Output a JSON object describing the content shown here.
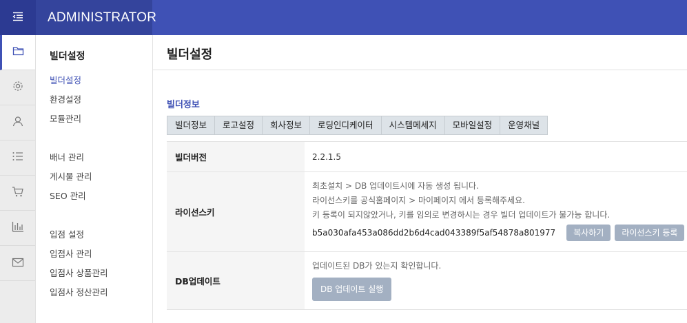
{
  "header": {
    "brand": "ADMINISTRATOR"
  },
  "iconbar": {
    "items": [
      {
        "icon": "folder-icon",
        "active": true
      },
      {
        "icon": "gear-icon"
      },
      {
        "icon": "user-icon"
      },
      {
        "icon": "list-icon"
      },
      {
        "icon": "cart-icon"
      },
      {
        "icon": "bar-chart-icon"
      },
      {
        "icon": "mail-icon"
      }
    ]
  },
  "sidebar": {
    "title": "빌더설정",
    "items": [
      {
        "label": "빌더설정",
        "active": true
      },
      {
        "label": "환경설정"
      },
      {
        "label": "모듈관리"
      },
      {
        "label": "배너 관리"
      },
      {
        "label": "게시물 관리"
      },
      {
        "label": "SEO 관리"
      },
      {
        "label": "입점 설정"
      },
      {
        "label": "입점사 관리"
      },
      {
        "label": "입점사 상품관리"
      },
      {
        "label": "입점사 정산관리"
      }
    ]
  },
  "main": {
    "page_title": "빌더설정",
    "section_title": "빌더정보",
    "tabs": [
      {
        "label": "빌더정보"
      },
      {
        "label": "로고설정"
      },
      {
        "label": "회사정보"
      },
      {
        "label": "로딩인디케이터"
      },
      {
        "label": "시스템메세지"
      },
      {
        "label": "모바일설정"
      },
      {
        "label": "운영채널"
      }
    ],
    "rows": {
      "version": {
        "label": "빌더버전",
        "value": "2.2.1.5"
      },
      "license": {
        "label": "라이선스키",
        "notes": [
          "최초설치 > DB 업데이트시에 자동 생성 됩니다.",
          "라이선스키를 공식홈페이지 > 마이페이지 에서 등록해주세요.",
          "키 등록이 되지않았거나, 키를 임의로 변경하시는 경우 빌더 업데이트가 불가능 합니다."
        ],
        "key": "b5a030afa453a086dd2b6d4cad043389f5af54878a801977",
        "copy_button": "복사하기",
        "register_button": "라이선스키 등록"
      },
      "db_update": {
        "label": "DB업데이트",
        "note": "업데이트된 DB가 있는지 확인합니다.",
        "button": "DB 업데이트 실행"
      }
    }
  },
  "colors": {
    "primary": "#3f51b5",
    "brand_bg": "#34449c",
    "toggle_bg": "#2c3a92",
    "button": "#a3b0c2"
  }
}
